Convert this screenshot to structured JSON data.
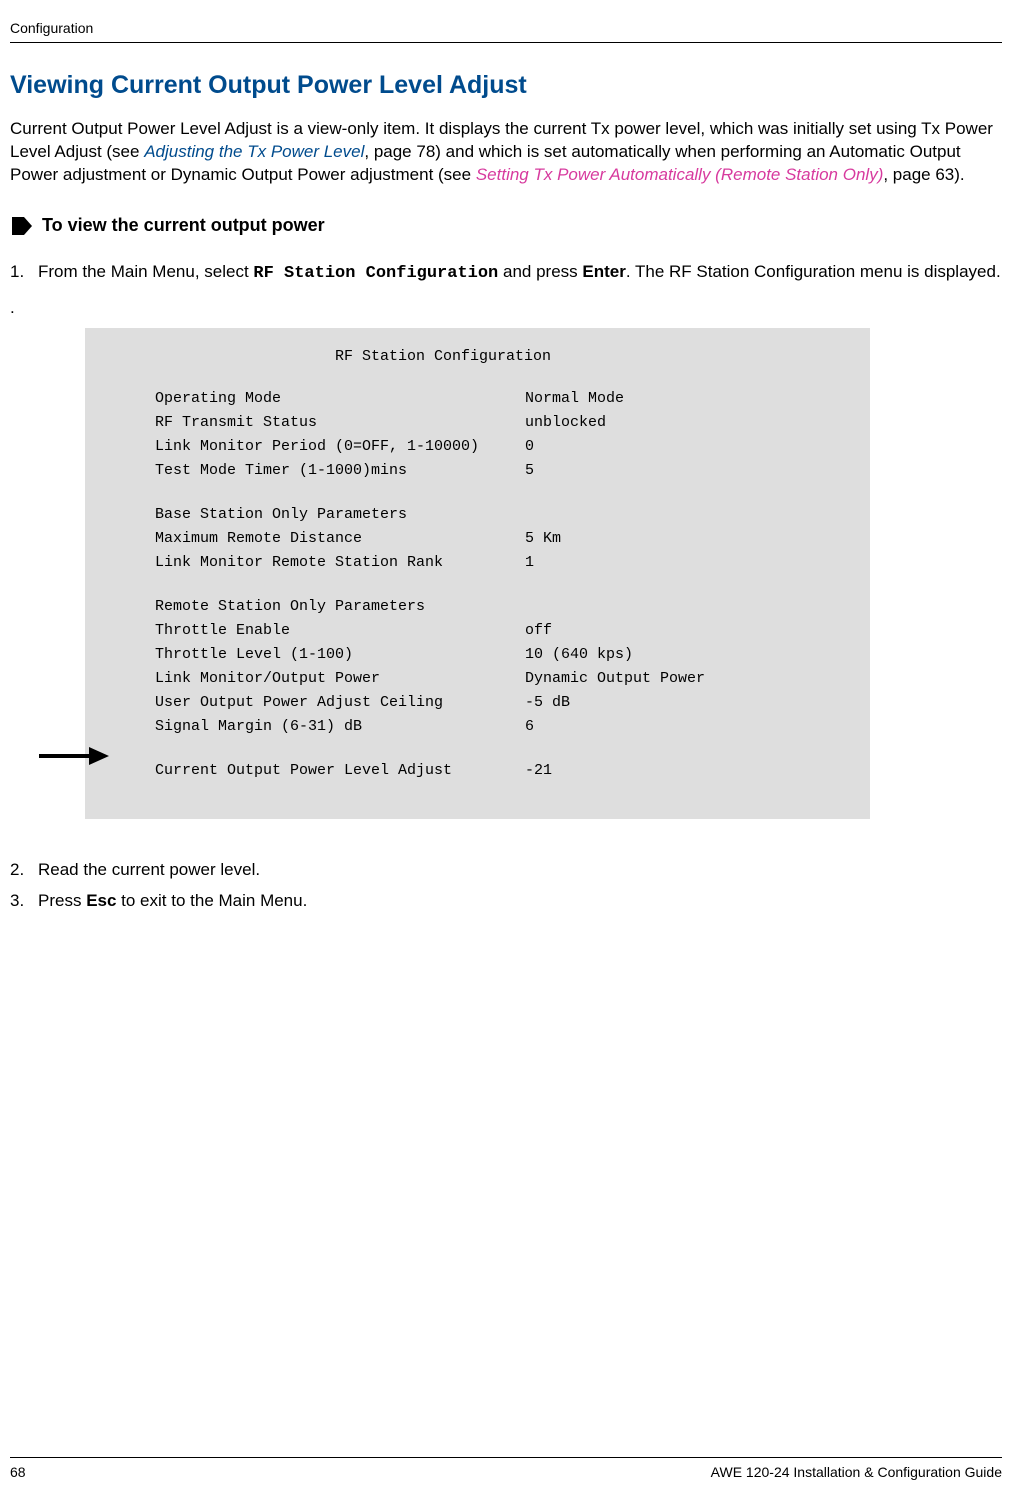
{
  "header": {
    "section": "Configuration"
  },
  "title": "Viewing Current Output Power Level Adjust",
  "intro": {
    "part1": "Current Output Power Level Adjust is a view-only item. It displays the current Tx power level, which was initially set using Tx Power Level Adjust (see ",
    "link1": "Adjusting the Tx Power Level",
    "part2": ", page 78) and which is set automatically when performing an Automatic Output Power adjustment or Dynamic Output Power adjustment (see ",
    "link2": "Setting Tx Power Automatically (Remote Station Only)",
    "part3": ", page 63)."
  },
  "subheading": "To view the current output power",
  "step1": {
    "num": "1.",
    "pre": "From the Main Menu, select ",
    "code": "RF Station Configuration",
    "mid": " and press ",
    "bold": "Enter",
    "post": ". The RF Station Configuration menu is displayed."
  },
  "dot": ".",
  "screen": {
    "title": "RF Station Configuration",
    "rows": [
      {
        "label": "Operating Mode",
        "value": "Normal Mode"
      },
      {
        "label": "RF Transmit Status",
        "value": "unblocked"
      },
      {
        "label": "Link Monitor Period (0=OFF, 1-10000)",
        "value": "0"
      },
      {
        "label": "Test Mode Timer (1-1000)mins",
        "value": "5"
      }
    ],
    "baseHeader": "Base Station Only Parameters",
    "baseRows": [
      {
        "label": "Maximum Remote Distance",
        "value": "5 Km"
      },
      {
        "label": "Link Monitor Remote Station Rank",
        "value": "1"
      }
    ],
    "remoteHeader": "Remote Station Only Parameters",
    "remoteRows": [
      {
        "label": "Throttle Enable",
        "value": "off"
      },
      {
        "label": "Throttle Level (1-100)",
        "value": "10   (640 kps)"
      },
      {
        "label": "Link Monitor/Output Power",
        "value": "Dynamic Output Power"
      },
      {
        "label": "User Output Power Adjust Ceiling",
        "value": "-5  dB"
      },
      {
        "label": "Signal Margin (6-31) dB",
        "value": " 6"
      }
    ],
    "currentRow": {
      "label": "Current Output Power Level Adjust",
      "value": "-21"
    }
  },
  "step2": {
    "num": "2.",
    "text": "Read the current power level."
  },
  "step3": {
    "num": "3.",
    "pre": " Press ",
    "bold": "Esc",
    "post": " to exit to the Main Menu."
  },
  "footer": {
    "page": "68",
    "guide": "AWE 120-24 Installation & Configuration Guide"
  }
}
